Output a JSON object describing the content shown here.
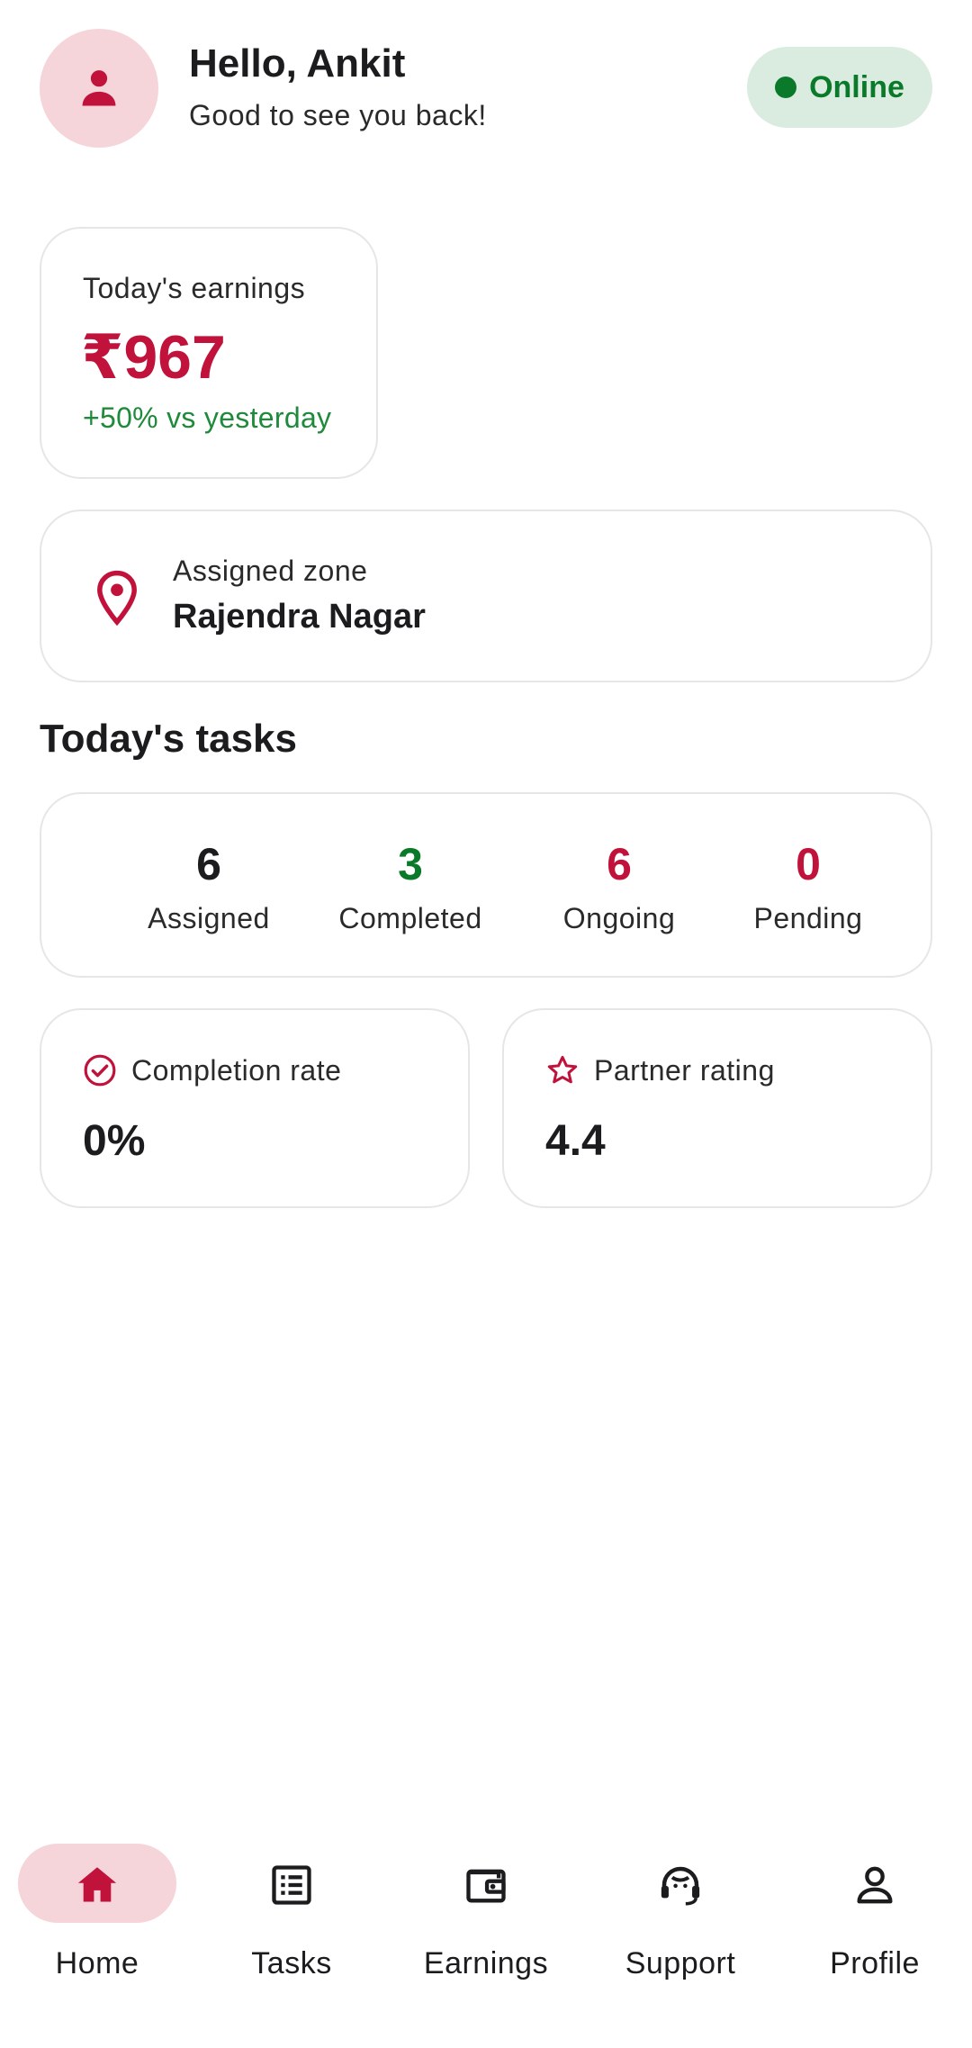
{
  "header": {
    "greeting": "Hello, Ankit",
    "subtitle": "Good to see you back!",
    "avatar_icon": "person-icon",
    "status": "Online",
    "status_color": "#0a7a2a"
  },
  "earnings": {
    "label": "Today's earnings",
    "value": "₹967",
    "delta": "+50% vs yesterday",
    "value_color": "#c0123a",
    "delta_color": "#1e8a3a"
  },
  "zone": {
    "icon": "location-pin-icon",
    "label": "Assigned zone",
    "value": "Rajendra Nagar"
  },
  "tasks": {
    "title": "Today's tasks",
    "stats": [
      {
        "value": "6",
        "label": "Assigned",
        "color": "#1c1c1e"
      },
      {
        "value": "3",
        "label": "Completed",
        "color": "#0a7a2a"
      },
      {
        "value": "6",
        "label": "Ongoing",
        "color": "#c0123a"
      },
      {
        "value": "0",
        "label": "Pending",
        "color": "#c0123a"
      }
    ]
  },
  "metrics": {
    "completion": {
      "icon": "check-circle-icon",
      "label": "Completion rate",
      "value": "0%"
    },
    "rating": {
      "icon": "star-icon",
      "label": "Partner rating",
      "value": "4.4"
    }
  },
  "nav": {
    "items": [
      {
        "label": "Home",
        "icon": "home-icon",
        "active": true
      },
      {
        "label": "Tasks",
        "icon": "list-icon",
        "active": false
      },
      {
        "label": "Earnings",
        "icon": "wallet-icon",
        "active": false
      },
      {
        "label": "Support",
        "icon": "headset-icon",
        "active": false
      },
      {
        "label": "Profile",
        "icon": "person-outline-icon",
        "active": false
      }
    ]
  },
  "colors": {
    "accent": "#c0123a",
    "accent_soft": "#f5d4da",
    "success": "#0a7a2a",
    "success_soft": "#d9ecdf"
  }
}
